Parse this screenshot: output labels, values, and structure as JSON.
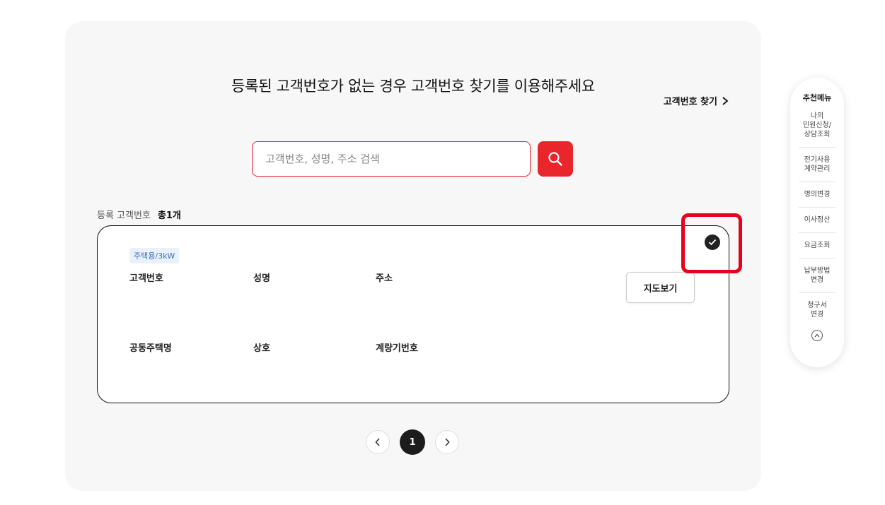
{
  "page": {
    "title": "등록된 고객번호가 없는 경우 고객번호 찾기를 이용해주세요",
    "find_link": "고객번호 찾기"
  },
  "search": {
    "placeholder": "고객번호, 성명, 주소 검색",
    "value": ""
  },
  "registered": {
    "label": "등록 고객번호",
    "count": "총1개"
  },
  "card": {
    "badge": "주택용/3kW",
    "fields": [
      "고객번호",
      "성명",
      "주소",
      "공동주택명",
      "상호",
      "계량기번호"
    ],
    "map_button": "지도보기",
    "selected": true
  },
  "pagination": {
    "current": "1"
  },
  "quick_menu": {
    "title": "추천메뉴",
    "items": [
      "나의\n민원신청/\n상담조회",
      "전기사용\n계약관리",
      "명의변경",
      "이사정산",
      "요금조회",
      "납부방법\n변경",
      "청구서\n변경"
    ]
  },
  "colors": {
    "accent": "#e8262b",
    "highlight": "#e8001c",
    "badge_bg": "#eaf1fb",
    "badge_text": "#3a6fc4"
  }
}
